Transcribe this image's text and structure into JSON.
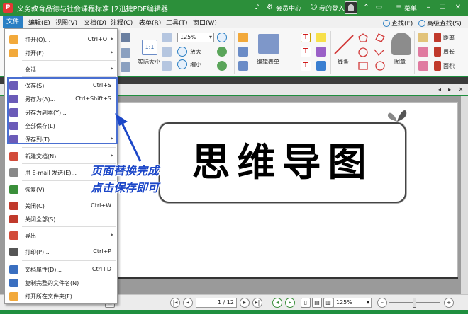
{
  "titlebar": {
    "app_icon": "P",
    "title": "义务教育品德与社会课程标准 [2迅捷PDF编辑器",
    "member_center": "会员中心",
    "login": "我的登入口",
    "menu": "菜单"
  },
  "menubar": {
    "items": [
      "文件",
      "编辑(E)",
      "视图(V)",
      "文档(D)",
      "注释(C)",
      "表单(R)",
      "工具(T)",
      "窗口(W)"
    ],
    "right": [
      "查找(F)",
      "高级查找(S)"
    ]
  },
  "ribbon": {
    "zoom_value": "125%",
    "actual_size": "实际大小",
    "zoom_in": "放大",
    "zoom_out": "缩小",
    "edit_form": "编辑表单",
    "line": "线条",
    "stamp": "图章",
    "distance": "距离",
    "perimeter": "周长",
    "area": "面积"
  },
  "file_menu": {
    "items": [
      {
        "label": "打开(O)...",
        "shortcut": "Ctrl+O",
        "submenu": true,
        "icon": "folder-open-icon",
        "color": "#f2a93b"
      },
      {
        "label": "打开(F)",
        "shortcut": "",
        "submenu": true,
        "icon": "folder-icon",
        "color": "#f2a93b"
      },
      {
        "label": "会话",
        "shortcut": "",
        "submenu": true,
        "icon": "",
        "color": ""
      },
      {
        "label": "保存(S)",
        "shortcut": "Ctrl+S",
        "submenu": false,
        "icon": "floppy-icon",
        "color": "#6b5bb8"
      },
      {
        "label": "另存为(A)...",
        "shortcut": "Ctrl+Shift+S",
        "submenu": false,
        "icon": "floppy-edit-icon",
        "color": "#6b5bb8"
      },
      {
        "label": "另存为副本(Y)...",
        "shortcut": "",
        "submenu": false,
        "icon": "floppy-copy-icon",
        "color": "#6b5bb8"
      },
      {
        "label": "全部保存(L)",
        "shortcut": "",
        "submenu": false,
        "icon": "floppy-multi-icon",
        "color": "#6b5bb8"
      },
      {
        "label": "保存到(T)",
        "shortcut": "",
        "submenu": true,
        "icon": "floppy-arrow-icon",
        "color": "#6b5bb8"
      },
      {
        "label": "新建文档(N)",
        "shortcut": "",
        "submenu": true,
        "icon": "new-doc-icon",
        "color": "#d24b3a"
      },
      {
        "label": "用 E-mail 发送(E)...",
        "shortcut": "",
        "submenu": false,
        "icon": "email-icon",
        "color": "#888"
      },
      {
        "label": "恢复(V)",
        "shortcut": "",
        "submenu": false,
        "icon": "restore-icon",
        "color": "#3a8f3a"
      },
      {
        "label": "关闭(C)",
        "shortcut": "Ctrl+W",
        "submenu": false,
        "icon": "close-doc-icon",
        "color": "#c0392b"
      },
      {
        "label": "关闭全部(S)",
        "shortcut": "",
        "submenu": false,
        "icon": "close-all-icon",
        "color": "#c0392b"
      },
      {
        "label": "导出",
        "shortcut": "",
        "submenu": true,
        "icon": "export-icon",
        "color": "#d24b3a"
      },
      {
        "label": "打印(P)...",
        "shortcut": "Ctrl+P",
        "submenu": false,
        "icon": "printer-icon",
        "color": "#555"
      },
      {
        "label": "文档属性(D)...",
        "shortcut": "Ctrl+D",
        "submenu": false,
        "icon": "doc-props-icon",
        "color": "#3a6fc0"
      },
      {
        "label": "复制完整的文件名(N)",
        "shortcut": "",
        "submenu": false,
        "icon": "copy-path-icon",
        "color": "#3a6fc0"
      },
      {
        "label": "打开所在文件夹(F)...",
        "shortcut": "",
        "submenu": false,
        "icon": "open-folder-icon",
        "color": "#f2a93b"
      }
    ]
  },
  "document": {
    "banner_text": "思维导图"
  },
  "annotation": {
    "line1": "页面替换完成",
    "line2": "点击保存即可"
  },
  "statusbar": {
    "page_value": "1 / 12",
    "zoom_value": "125%"
  },
  "colors": {
    "title_green": "#2c8f3a",
    "menu_highlight": "#2a7fc4",
    "annotation_blue": "#1c47c8",
    "save_box": "#4a6fd1"
  }
}
